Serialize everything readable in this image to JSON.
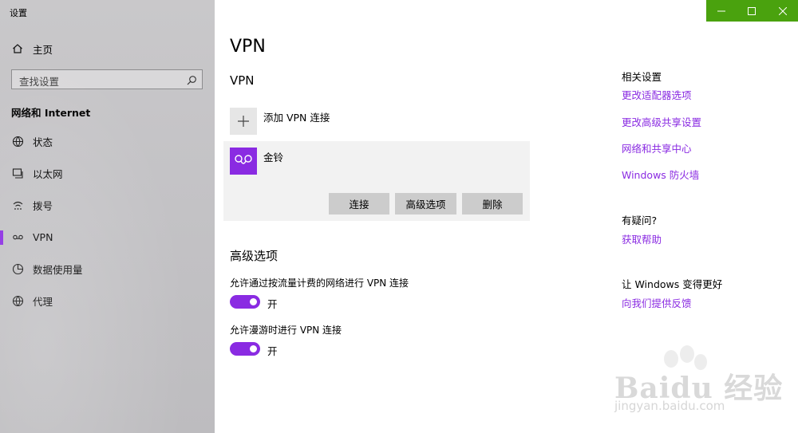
{
  "window": {
    "title": "设置"
  },
  "sidebar": {
    "home": "主页",
    "search_placeholder": "查找设置",
    "section": "网络和 Internet",
    "items": [
      {
        "label": "状态",
        "icon": "globe-status-icon"
      },
      {
        "label": "以太网",
        "icon": "ethernet-icon"
      },
      {
        "label": "拨号",
        "icon": "dialup-icon"
      },
      {
        "label": "VPN",
        "icon": "vpn-icon",
        "active": true
      },
      {
        "label": "数据使用量",
        "icon": "data-usage-icon"
      },
      {
        "label": "代理",
        "icon": "proxy-globe-icon"
      }
    ]
  },
  "main": {
    "title": "VPN",
    "section_vpn": "VPN",
    "add_label": "添加 VPN 连接",
    "connection": {
      "name": "金铃",
      "buttons": [
        "连接",
        "高级选项",
        "删除"
      ]
    },
    "advanced_title": "高级选项",
    "options": [
      {
        "label": "允许通过按流量计费的网络进行 VPN 连接",
        "state": "开",
        "on": true
      },
      {
        "label": "允许漫游时进行 VPN 连接",
        "state": "开",
        "on": true
      }
    ]
  },
  "right": {
    "related_heading": "相关设置",
    "related_links": [
      "更改适配器选项",
      "更改高级共享设置",
      "网络和共享中心",
      "Windows 防火墙"
    ],
    "question_heading": "有疑问?",
    "help_link": "获取帮助",
    "better_heading": "让 Windows 变得更好",
    "feedback_link": "向我们提供反馈"
  },
  "watermark": {
    "text": "Baidu 经验",
    "sub": "jingyan.baidu.com"
  },
  "colors": {
    "accent": "#8a2be2",
    "titlebar": "#4aa20e"
  }
}
